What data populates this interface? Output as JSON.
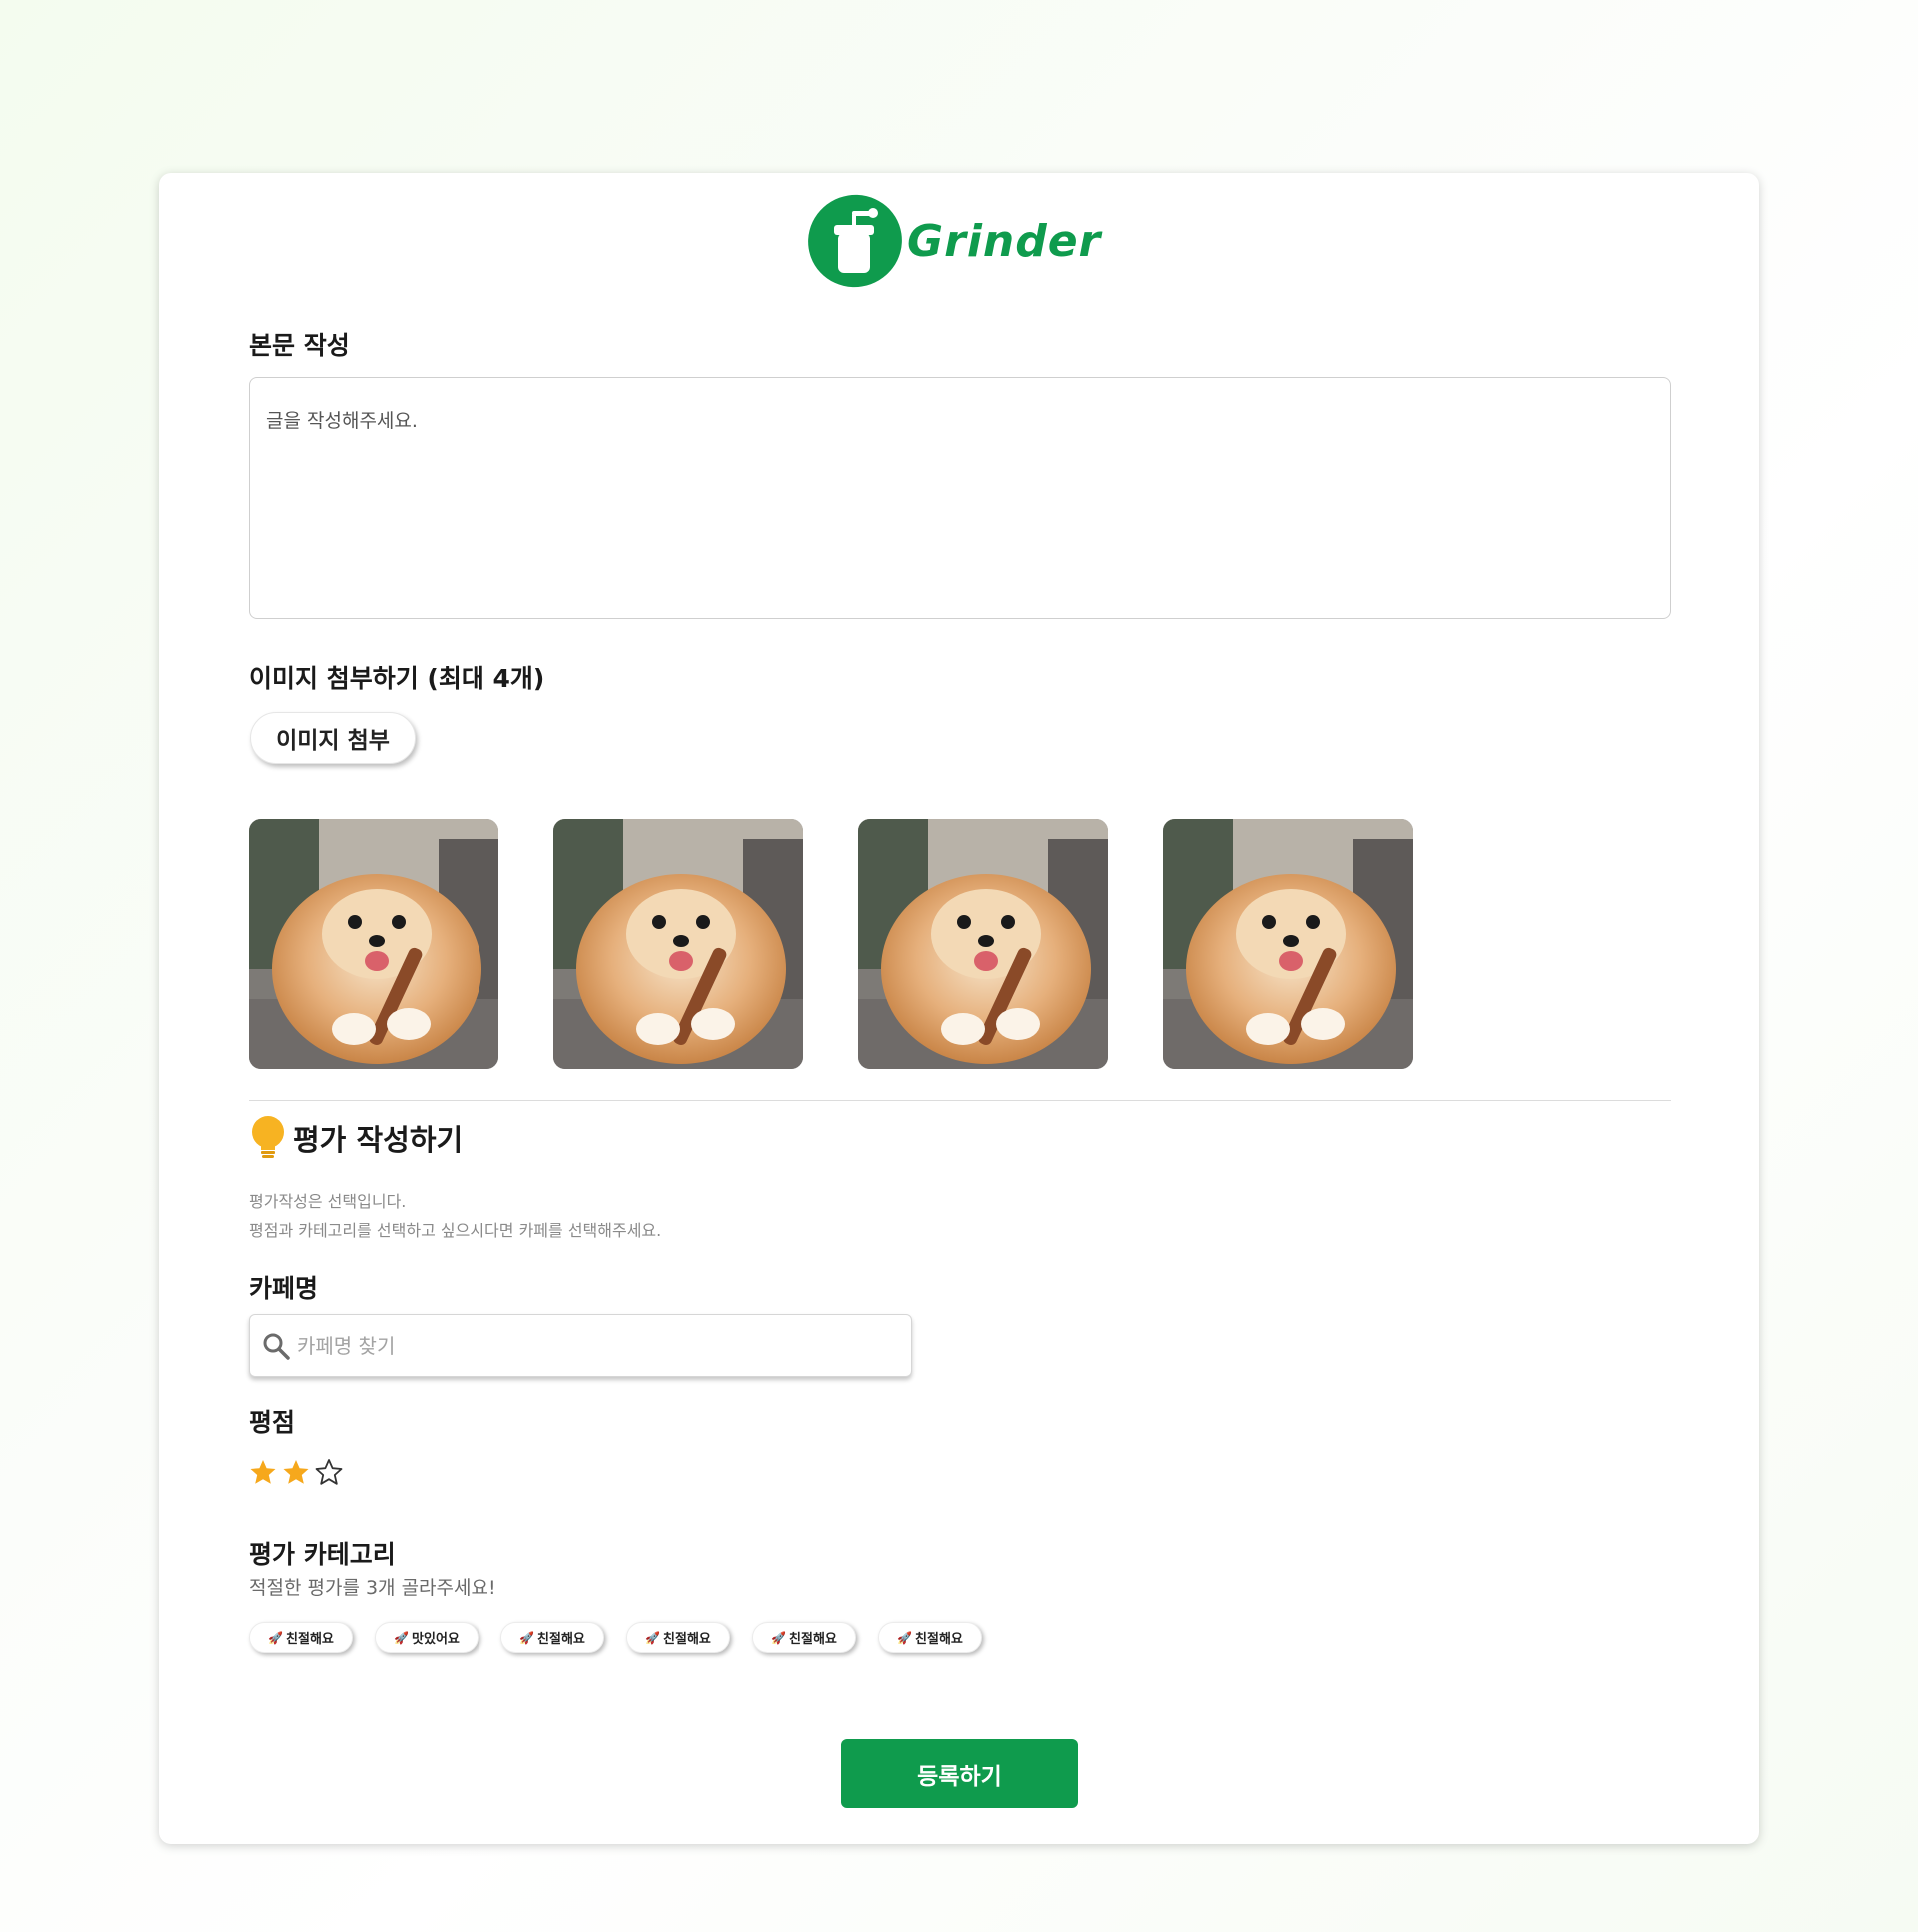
{
  "brand": {
    "name": "Grinder",
    "color": "#0f9b4d"
  },
  "content": {
    "label": "본문 작성",
    "placeholder": "글을 작성해주세요.",
    "value": ""
  },
  "images": {
    "label": "이미지 첨부하기 (최대 4개)",
    "button_label": "이미지 첨부",
    "thumbnails": [
      {
        "alt": "pomeranian-photo"
      },
      {
        "alt": "pomeranian-photo"
      },
      {
        "alt": "pomeranian-photo"
      },
      {
        "alt": "pomeranian-photo"
      }
    ]
  },
  "review": {
    "icon": "lightbulb-icon",
    "title": "평가 작성하기",
    "help_line1": "평가작성은 선택입니다.",
    "help_line2": "평점과 카테고리를 선택하고 싶으시다면 카페를 선택해주세요.",
    "cafe_label": "카페명",
    "cafe_search_placeholder": "카페명 찾기",
    "rating_label": "평점",
    "rating": 2,
    "rating_max": 3,
    "star_color": "#f6a81c",
    "category_label": "평가 카테고리",
    "category_sub": "적절한 평가를 3개 골라주세요!",
    "categories": [
      {
        "emoji": "🚀",
        "label": "친절해요"
      },
      {
        "emoji": "🚀",
        "label": "맛있어요"
      },
      {
        "emoji": "🚀",
        "label": "친절해요"
      },
      {
        "emoji": "🚀",
        "label": "친절해요"
      },
      {
        "emoji": "🚀",
        "label": "친절해요"
      },
      {
        "emoji": "🚀",
        "label": "친절해요"
      }
    ]
  },
  "submit": {
    "label": "등록하기"
  }
}
